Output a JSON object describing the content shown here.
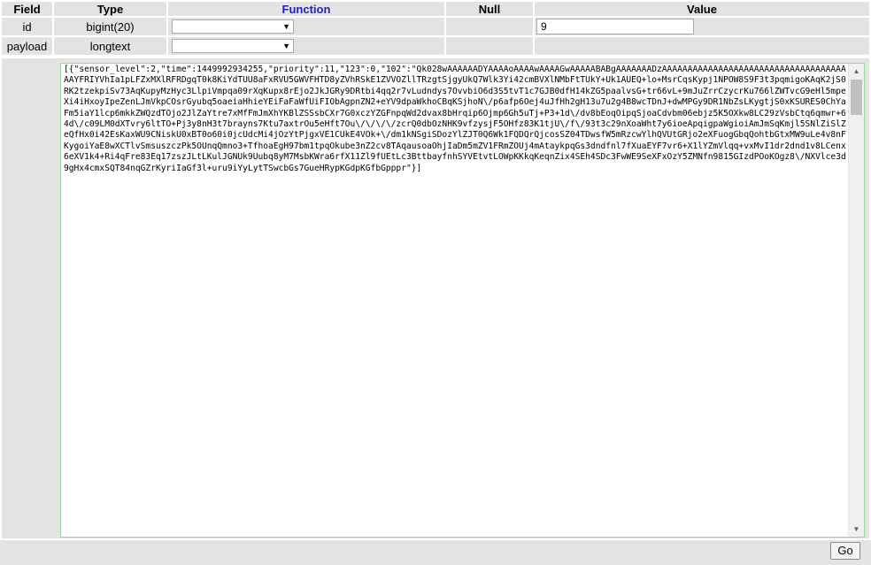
{
  "headers": {
    "field": "Field",
    "type": "Type",
    "function": "Function",
    "null": "Null",
    "value": "Value"
  },
  "rows": [
    {
      "field": "id",
      "type": "bigint(20)",
      "function_selected": "",
      "value": "9"
    },
    {
      "field": "payload",
      "type": "longtext",
      "function_selected": ""
    }
  ],
  "payload_text": "[{\"sensor_level\":2,\"time\":1449992934255,\"priority\":11,\"123\":0,\"102\":\"Qk028wAAAAAADYAAAAoAAAAwAAAAGwAAAAABABgAAAAAAADzAAAAAAAAAAAAAAAAAAAAAAAAAAAAAAAAAAAAAAYFRIYVhIa1pLFZxMXlRFRDgqT0k8KiYdTUU8aFxRVU5GWVFHTD8yZVhRSkE1ZVVOZllTRzgtSjgyUkQ7Wlk3Yi42cmBVXlNMbFtTUkY+Uk1AUEQ+lo+MsrCqsKypj1NPOW8S9F3t3pqmigoKAqK2jS0RK2tzekpiSv73AqKupyMzHyc3LlpiVmpqa09rXqKupx8rEjo2JkJGRy9DRtbi4qq2r7vLudndys7OvvbiO6d3S5tvT1c7GJB0dfH14kZG5paalvsG+tr66vL+9mJuZrrCzycrKu766lZWTvcG9eHl5mpeXi4iHxoyIpeZenLJmVkpCOsrGyubq5oaeiaHhieYEiFaFaWfUiFIObAgpnZN2+eYV9dpaWkhoCBqKSjhoN\\/p6afp6Oej4uJfHh2gH13u7u2g4B8wcTDnJ+dwMPGy9DR1NbZsLKygtjS0xKSURES0ChYaFm5iaY1lcp6mkkZWQzdTOjo2JlZaYtre7xMfFmJmXhYKBlZSSsbCXr7G0xczYZGFnpqWd2dvax8bHrqip6Ojmp6Gh5uTj+P3+1d\\/dv8bEoqOipqSjoaCdvbm06ebjz5K5OXkw8LC29zVsbCtq6qmwr+64d\\/c09LM0dXTvry6ltTO+Pj3y8nH3t7brayns7Ktu7axtrOu5eHft7Ou\\/\\/\\/\\/zcrQ0dbOzNHK9vfzysjF5OHfz83K1tjU\\/f\\/93t3c29nXoaWht7y6ioeApqigpaWgioiAmJmSqKmjl5SNlZiSlZeQfHx0i42EsKaxWU9CNiskU0xBT0o60i0jcUdcMi4jOzYtPjgxVE1CUkE4VOk+\\/dm1kNSgiSDozYlZJT0Q6Wk1FQDQrQjcosSZ04TDwsfW5mRzcwYlhQVUtGRjo2eXFuogGbqQohtbGtxMW9uLe4v8nFKygoiYaE8wXCTlvSmsuszczPk5OUnqQmno3+TfhoaEgH97bm1tpqOkube3nZ2cv8TAqausoaOhjIaDm5mZV1FRmZOUj4mAtaykpqGs3dndfnl7fXuaEYF7vr6+X1lYZmVlqq+vxMvI1dr2dnd1v8LCenx6eXV1k4+Ri4qFre83Eq17zszJLtLKulJGNUk9Uubq8yM7MsbKWra6rfX11Zl9fUEtLc3BttbayfnhSYVEtvtLOWpKKkqKeqnZix4SEh4SDc3FwWE9SeXFxOzY5ZMNfn9815GIzdPOoKOgz8\\/NXVlce3d9gHx4cmxSQT84nqGZrKyriIaGf3l+uru9iYyLytTSwcbGs7GueHRypKGdpKGfbGpppr\"}]"
}
